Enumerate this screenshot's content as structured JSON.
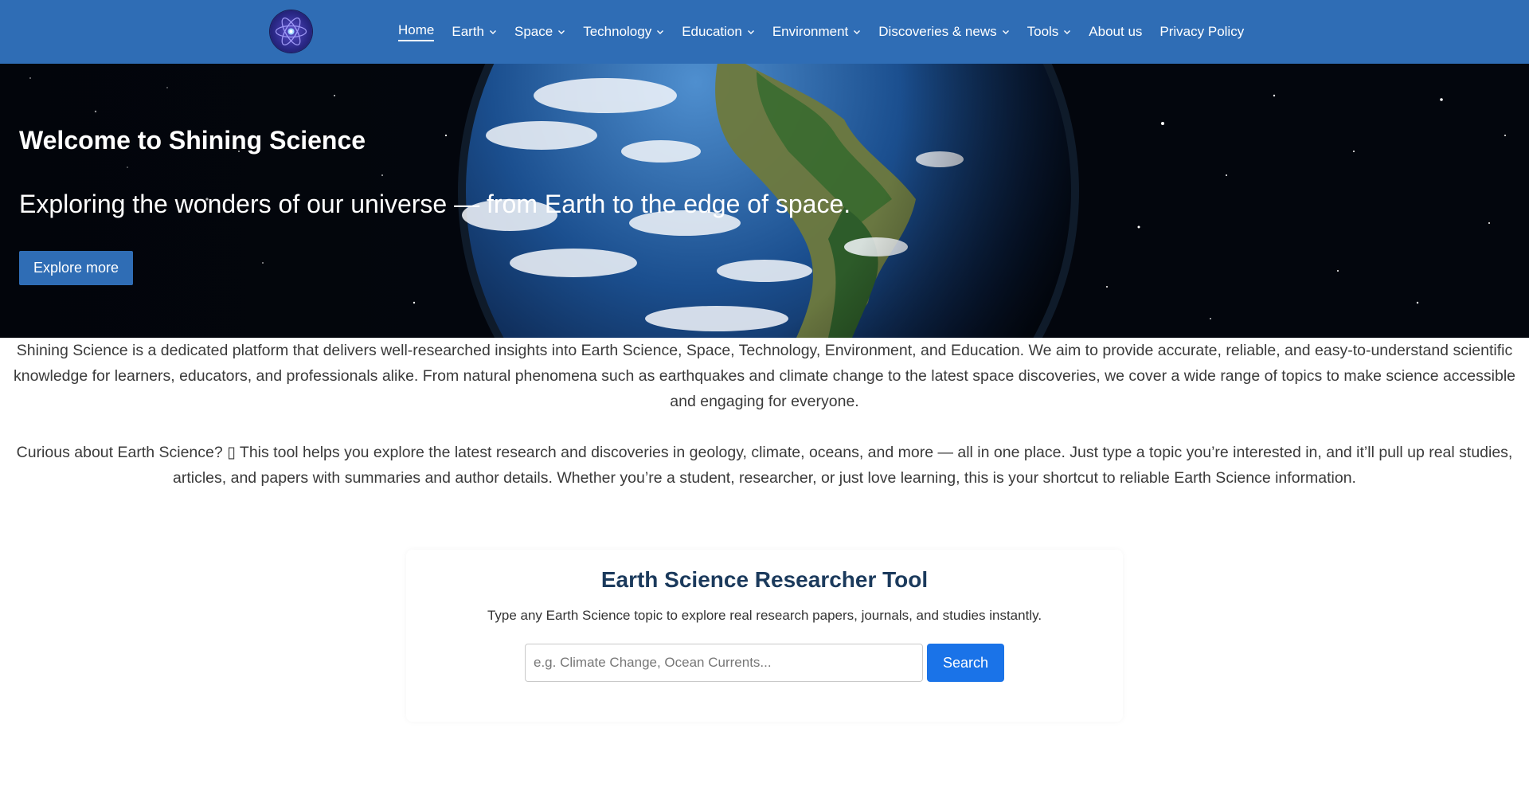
{
  "header": {
    "logo_icon": "atom-logo-icon",
    "nav": [
      {
        "label": "Home",
        "active": true,
        "dropdown": false
      },
      {
        "label": "Earth",
        "active": false,
        "dropdown": true
      },
      {
        "label": "Space",
        "active": false,
        "dropdown": true
      },
      {
        "label": "Technology",
        "active": false,
        "dropdown": true
      },
      {
        "label": "Education",
        "active": false,
        "dropdown": true
      },
      {
        "label": "Environment",
        "active": false,
        "dropdown": true
      },
      {
        "label": "Discoveries & news",
        "active": false,
        "dropdown": true
      },
      {
        "label": "Tools",
        "active": false,
        "dropdown": true
      },
      {
        "label": "About us",
        "active": false,
        "dropdown": false
      },
      {
        "label": "Privacy Policy",
        "active": false,
        "dropdown": false
      }
    ],
    "background_color": "#2f6db5"
  },
  "hero": {
    "title": "Welcome to Shining Science",
    "subtitle": "Exploring the wonders of our universe — from Earth to the edge of space.",
    "button_label": "Explore more",
    "image": "earth-from-space-image"
  },
  "intro": {
    "text": "Shining Science is a dedicated platform that delivers well-researched insights into Earth Science, Space, Technology, Environment, and Education. We aim to provide accurate, reliable, and easy-to-understand scientific knowledge for learners, educators, and professionals alike. From natural phenomena such as earthquakes and climate change to the latest space discoveries, we cover a wide range of topics to make science accessible and engaging for everyone."
  },
  "curious": {
    "text": "Curious about Earth Science? ▯ This tool helps you explore the latest research and discoveries in geology, climate, oceans, and more — all in one place. Just type a topic you’re interested in, and it’ll pull up real studies, articles, and papers with summaries and author details. Whether you’re a student, researcher, or just love learning, this is your shortcut to reliable Earth Science information."
  },
  "tool": {
    "title": "Earth Science Researcher Tool",
    "description": "Type any Earth Science topic to explore real research papers, journals, and studies instantly.",
    "search_placeholder": "e.g. Climate Change, Ocean Currents...",
    "search_value": "",
    "search_button": "Search",
    "accent_color": "#1a73e8"
  }
}
